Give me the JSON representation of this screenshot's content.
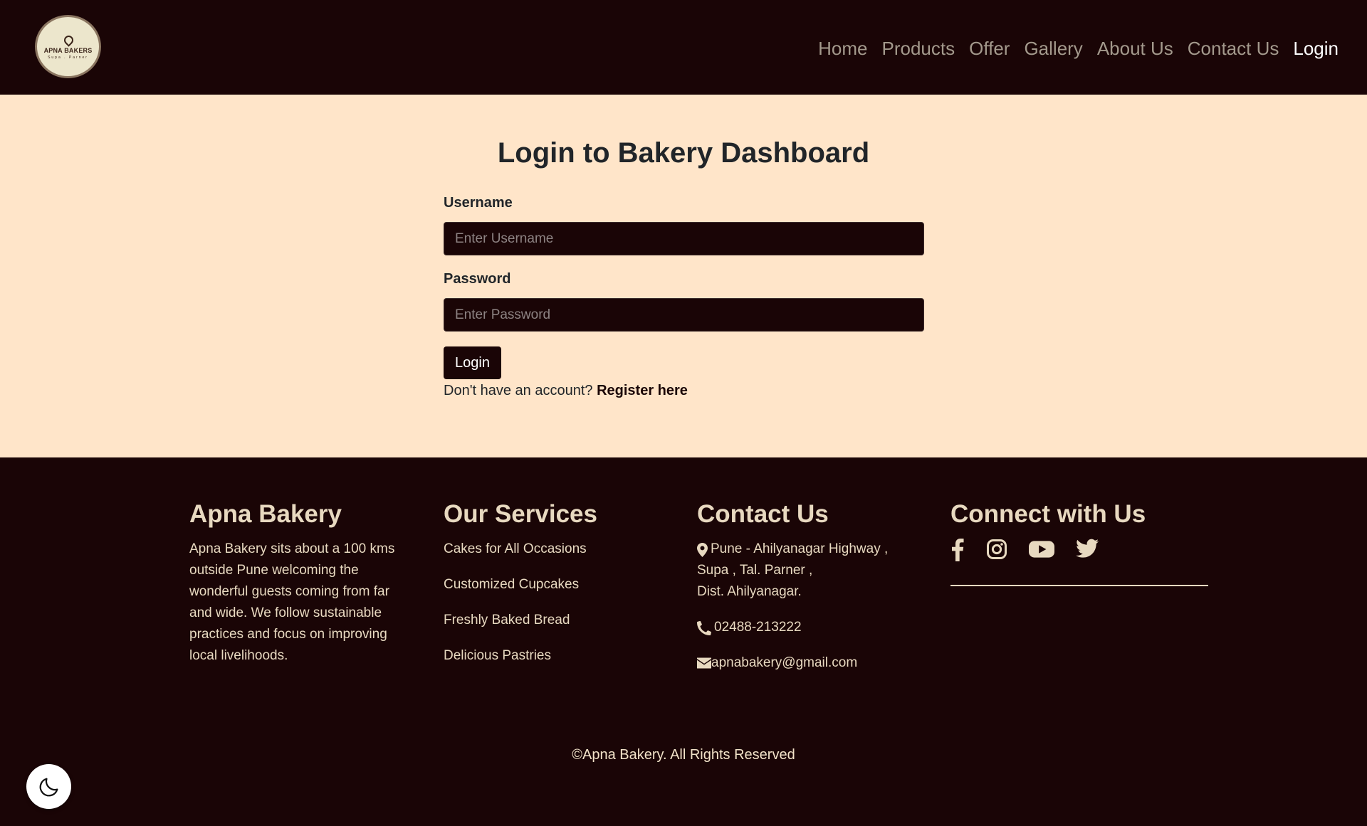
{
  "header": {
    "logo": {
      "brand": "APNA BAKERS",
      "sub": "Supa . Parner"
    },
    "nav": [
      "Home",
      "Products",
      "Offer",
      "Gallery",
      "About Us",
      "Contact Us",
      "Login"
    ]
  },
  "login": {
    "title": "Login to Bakery Dashboard",
    "username_label": "Username",
    "username_placeholder": "Enter Username",
    "password_label": "Password",
    "password_placeholder": "Enter Password",
    "button_label": "Login",
    "register_prompt": "Don't have an account?",
    "register_link": "Register here"
  },
  "footer": {
    "about": {
      "heading": "Apna Bakery",
      "text": "Apna Bakery sits about a 100 kms outside Pune welcoming the wonderful guests coming from far and wide. We follow sustainable practices and focus on improving local livelihoods."
    },
    "services": {
      "heading": "Our Services",
      "items": [
        "Cakes for All Occasions",
        "Customized Cupcakes",
        "Freshly Baked Bread",
        "Delicious Pastries"
      ]
    },
    "contact": {
      "heading": "Contact Us",
      "address_line1": "Pune - Ahilyanagar Highway ,",
      "address_line2": "Supa , Tal. Parner ,",
      "address_line3": "Dist. Ahilyanagar.",
      "phone": "02488-213222",
      "email": "apnabakery@gmail.com"
    },
    "connect": {
      "heading": "Connect with Us",
      "icons": [
        "facebook-icon",
        "instagram-icon",
        "youtube-icon",
        "twitter-icon"
      ]
    },
    "copyright": "©Apna Bakery. All Rights Reserved"
  },
  "colors": {
    "dark": "#1a0506",
    "cream": "#ffe5c9",
    "footer_text": "#e8d9c0"
  }
}
